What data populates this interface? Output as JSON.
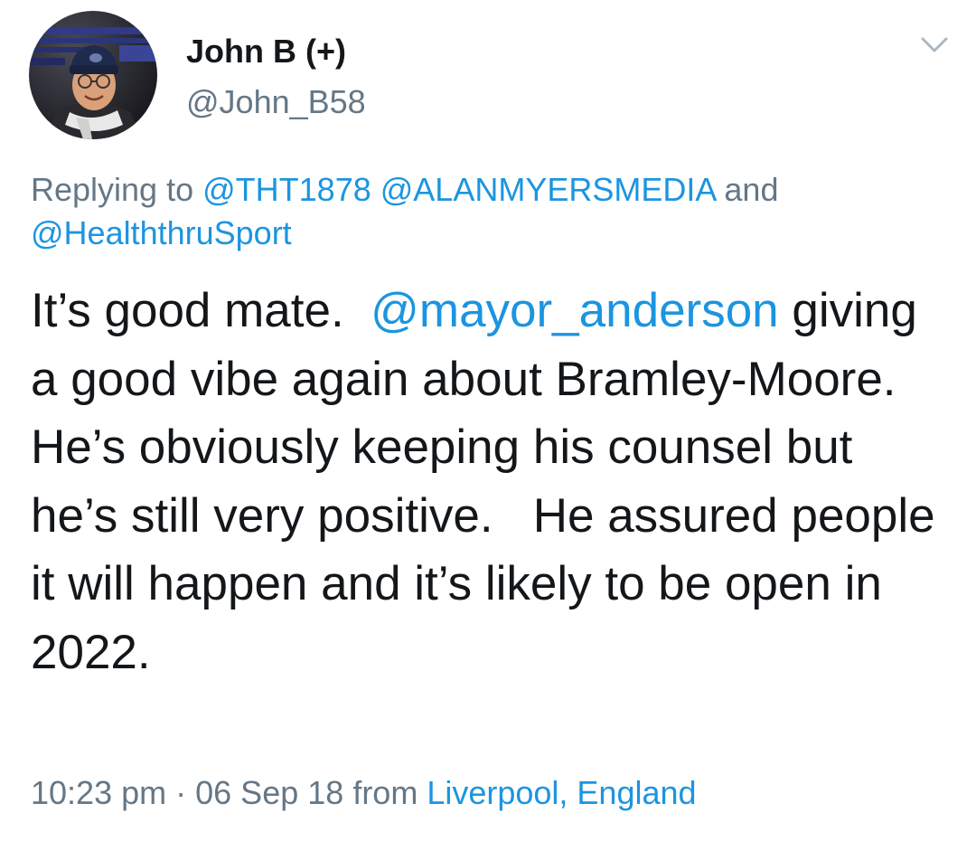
{
  "author": {
    "display_name": "John B (+)",
    "handle": "@John_B58",
    "avatar_icon": "profile-photo"
  },
  "menu": {
    "icon": "chevron-down-icon"
  },
  "reply": {
    "prefix": "Replying to",
    "mentions": [
      "@THT1878",
      "@ALANMYERSMEDIA",
      "@HealththruSport"
    ],
    "conjunction": "and"
  },
  "body": {
    "part1": "It’s good mate.  ",
    "mention": "@mayor_anderson",
    "part2": " giving a good vibe again about Bramley-Moore.   He’s obviously keeping his counsel but he’s still very positive.   He assured people it will happen and it’s likely to be open in 2022."
  },
  "meta": {
    "time": "10:23 pm",
    "separator": "·",
    "date": "06 Sep 18",
    "from_label": "from",
    "location": "Liverpool, England"
  },
  "colors": {
    "text": "#14171a",
    "secondary": "#657786",
    "link": "#1b95e0",
    "background": "#ffffff"
  }
}
